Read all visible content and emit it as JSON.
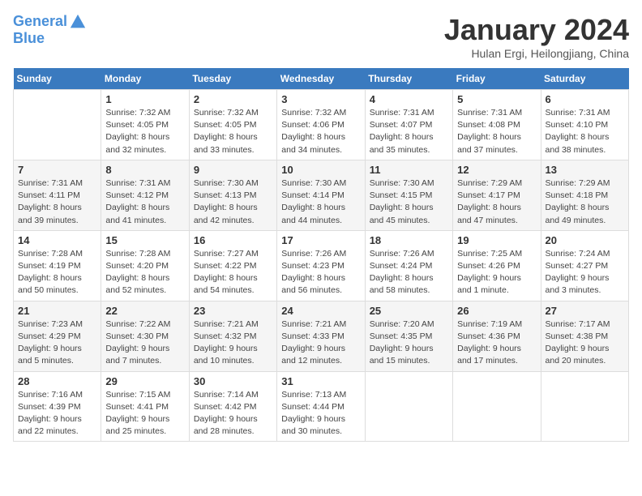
{
  "header": {
    "logo_line1": "General",
    "logo_line2": "Blue",
    "month_title": "January 2024",
    "subtitle": "Hulan Ergi, Heilongjiang, China"
  },
  "days_of_week": [
    "Sunday",
    "Monday",
    "Tuesday",
    "Wednesday",
    "Thursday",
    "Friday",
    "Saturday"
  ],
  "weeks": [
    [
      {
        "day": "",
        "info": ""
      },
      {
        "day": "1",
        "info": "Sunrise: 7:32 AM\nSunset: 4:05 PM\nDaylight: 8 hours\nand 32 minutes."
      },
      {
        "day": "2",
        "info": "Sunrise: 7:32 AM\nSunset: 4:05 PM\nDaylight: 8 hours\nand 33 minutes."
      },
      {
        "day": "3",
        "info": "Sunrise: 7:32 AM\nSunset: 4:06 PM\nDaylight: 8 hours\nand 34 minutes."
      },
      {
        "day": "4",
        "info": "Sunrise: 7:31 AM\nSunset: 4:07 PM\nDaylight: 8 hours\nand 35 minutes."
      },
      {
        "day": "5",
        "info": "Sunrise: 7:31 AM\nSunset: 4:08 PM\nDaylight: 8 hours\nand 37 minutes."
      },
      {
        "day": "6",
        "info": "Sunrise: 7:31 AM\nSunset: 4:10 PM\nDaylight: 8 hours\nand 38 minutes."
      }
    ],
    [
      {
        "day": "7",
        "info": "Sunrise: 7:31 AM\nSunset: 4:11 PM\nDaylight: 8 hours\nand 39 minutes."
      },
      {
        "day": "8",
        "info": "Sunrise: 7:31 AM\nSunset: 4:12 PM\nDaylight: 8 hours\nand 41 minutes."
      },
      {
        "day": "9",
        "info": "Sunrise: 7:30 AM\nSunset: 4:13 PM\nDaylight: 8 hours\nand 42 minutes."
      },
      {
        "day": "10",
        "info": "Sunrise: 7:30 AM\nSunset: 4:14 PM\nDaylight: 8 hours\nand 44 minutes."
      },
      {
        "day": "11",
        "info": "Sunrise: 7:30 AM\nSunset: 4:15 PM\nDaylight: 8 hours\nand 45 minutes."
      },
      {
        "day": "12",
        "info": "Sunrise: 7:29 AM\nSunset: 4:17 PM\nDaylight: 8 hours\nand 47 minutes."
      },
      {
        "day": "13",
        "info": "Sunrise: 7:29 AM\nSunset: 4:18 PM\nDaylight: 8 hours\nand 49 minutes."
      }
    ],
    [
      {
        "day": "14",
        "info": "Sunrise: 7:28 AM\nSunset: 4:19 PM\nDaylight: 8 hours\nand 50 minutes."
      },
      {
        "day": "15",
        "info": "Sunrise: 7:28 AM\nSunset: 4:20 PM\nDaylight: 8 hours\nand 52 minutes."
      },
      {
        "day": "16",
        "info": "Sunrise: 7:27 AM\nSunset: 4:22 PM\nDaylight: 8 hours\nand 54 minutes."
      },
      {
        "day": "17",
        "info": "Sunrise: 7:26 AM\nSunset: 4:23 PM\nDaylight: 8 hours\nand 56 minutes."
      },
      {
        "day": "18",
        "info": "Sunrise: 7:26 AM\nSunset: 4:24 PM\nDaylight: 8 hours\nand 58 minutes."
      },
      {
        "day": "19",
        "info": "Sunrise: 7:25 AM\nSunset: 4:26 PM\nDaylight: 9 hours\nand 1 minute."
      },
      {
        "day": "20",
        "info": "Sunrise: 7:24 AM\nSunset: 4:27 PM\nDaylight: 9 hours\nand 3 minutes."
      }
    ],
    [
      {
        "day": "21",
        "info": "Sunrise: 7:23 AM\nSunset: 4:29 PM\nDaylight: 9 hours\nand 5 minutes."
      },
      {
        "day": "22",
        "info": "Sunrise: 7:22 AM\nSunset: 4:30 PM\nDaylight: 9 hours\nand 7 minutes."
      },
      {
        "day": "23",
        "info": "Sunrise: 7:21 AM\nSunset: 4:32 PM\nDaylight: 9 hours\nand 10 minutes."
      },
      {
        "day": "24",
        "info": "Sunrise: 7:21 AM\nSunset: 4:33 PM\nDaylight: 9 hours\nand 12 minutes."
      },
      {
        "day": "25",
        "info": "Sunrise: 7:20 AM\nSunset: 4:35 PM\nDaylight: 9 hours\nand 15 minutes."
      },
      {
        "day": "26",
        "info": "Sunrise: 7:19 AM\nSunset: 4:36 PM\nDaylight: 9 hours\nand 17 minutes."
      },
      {
        "day": "27",
        "info": "Sunrise: 7:17 AM\nSunset: 4:38 PM\nDaylight: 9 hours\nand 20 minutes."
      }
    ],
    [
      {
        "day": "28",
        "info": "Sunrise: 7:16 AM\nSunset: 4:39 PM\nDaylight: 9 hours\nand 22 minutes."
      },
      {
        "day": "29",
        "info": "Sunrise: 7:15 AM\nSunset: 4:41 PM\nDaylight: 9 hours\nand 25 minutes."
      },
      {
        "day": "30",
        "info": "Sunrise: 7:14 AM\nSunset: 4:42 PM\nDaylight: 9 hours\nand 28 minutes."
      },
      {
        "day": "31",
        "info": "Sunrise: 7:13 AM\nSunset: 4:44 PM\nDaylight: 9 hours\nand 30 minutes."
      },
      {
        "day": "",
        "info": ""
      },
      {
        "day": "",
        "info": ""
      },
      {
        "day": "",
        "info": ""
      }
    ]
  ]
}
